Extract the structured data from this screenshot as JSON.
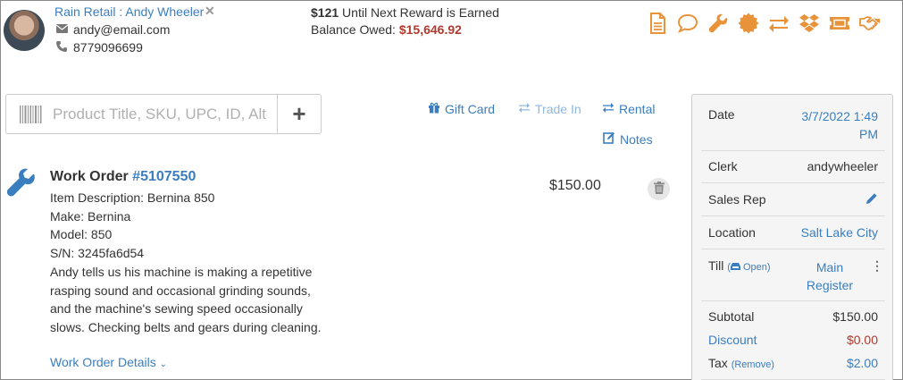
{
  "customer": {
    "name": "Rain Retail : Andy Wheeler",
    "email": "andy@email.com",
    "phone": "8779096699"
  },
  "rewards": {
    "reward_amount": "$121",
    "reward_text": " Until Next Reward is Earned",
    "balance_label": "Balance Owed: ",
    "balance_value": "$15,646.92"
  },
  "toolbar": {
    "icons": [
      "document-icon",
      "comment-icon",
      "wrench-icon",
      "badge-icon",
      "exchange-icon",
      "dropbox-icon",
      "ticket-icon",
      "handshake-icon"
    ],
    "icon_color": "#e8923a"
  },
  "search": {
    "placeholder": "Product Title, SKU, UPC, ID, Alternate SKU",
    "add_label": "+"
  },
  "actions": {
    "gift_card": "Gift Card",
    "trade_in": "Trade In",
    "rental": "Rental",
    "notes": "Notes"
  },
  "work_order": {
    "title": "Work Order ",
    "number": "#5107550",
    "description": "Item Description: Bernina 850",
    "make": "Make: Bernina",
    "model": "Model: 850",
    "serial": "S/N: 3245fa6d54",
    "notes": "Andy tells us his machine is making a repetitive rasping sound and occasional grinding sounds, and the machine's sewing speed occasionally slows. Checking belts and gears during cleaning.",
    "details_link": "Work Order Details",
    "price": "$150.00"
  },
  "summary": {
    "date_label": "Date",
    "date_value": "3/7/2022 1:49 PM",
    "clerk_label": "Clerk",
    "clerk_value": "andywheeler",
    "sales_rep_label": "Sales Rep",
    "location_label": "Location",
    "location_value": "Salt Lake City",
    "till_label": "Till",
    "till_status": "Open",
    "till_value": "Main Register",
    "subtotal_label": "Subtotal",
    "subtotal_value": "$150.00",
    "discount_label": "Discount",
    "discount_value": "$0.00",
    "tax_label": "Tax",
    "tax_remove": "(Remove)",
    "tax_value": "$2.00"
  },
  "colors": {
    "link": "#3a7ebf",
    "negative": "#b03a2e",
    "accent": "#e8923a"
  }
}
